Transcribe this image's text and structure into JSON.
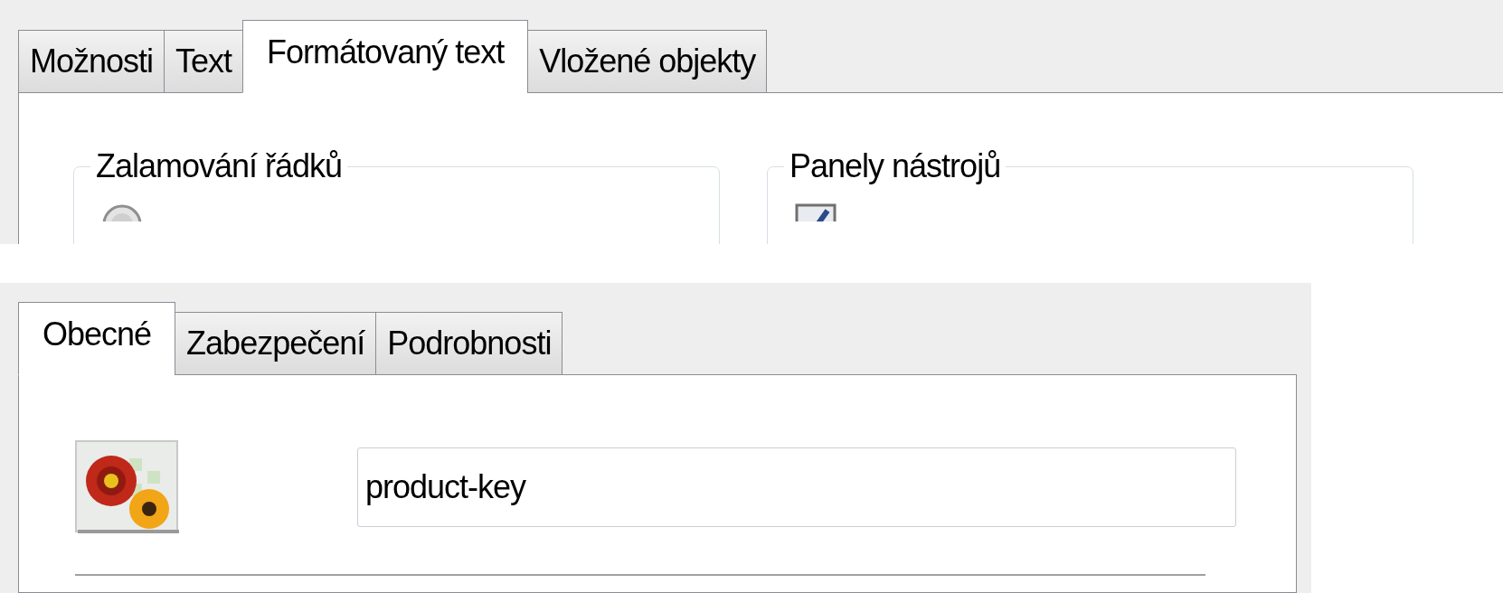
{
  "text_dialog": {
    "tabs": [
      {
        "label": "Možnosti",
        "selected": false
      },
      {
        "label": "Text",
        "selected": false
      },
      {
        "label": "Formátovaný text",
        "selected": true
      },
      {
        "label": "Vložené objekty",
        "selected": false
      }
    ],
    "groups": [
      {
        "kind": "radio",
        "title": "Zalamování řádků",
        "items": [
          {
            "selected": false
          }
        ]
      },
      {
        "kind": "checkbox",
        "title": "Panely nástrojů",
        "items": [
          {
            "checked": true
          }
        ]
      }
    ]
  },
  "properties_dialog": {
    "tabs": [
      {
        "label": "Obecné",
        "selected": true
      },
      {
        "label": "Zabezpečení",
        "selected": false
      },
      {
        "label": "Podrobnosti",
        "selected": false
      }
    ],
    "file_name": {
      "value": "product-key"
    }
  }
}
